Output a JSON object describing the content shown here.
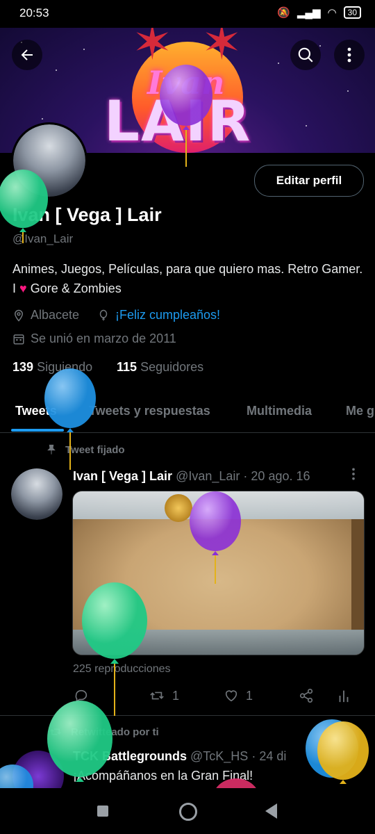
{
  "status_bar": {
    "time": "20:53",
    "battery": "30"
  },
  "banner": {
    "script_text": "Ivan",
    "title_text": "LAIR"
  },
  "header": {
    "back_icon": "arrow-left-icon",
    "search_icon": "search-icon",
    "more_icon": "more-vertical-icon"
  },
  "profile": {
    "edit_button": "Editar perfil",
    "name": "Ivan [ Vega ] Lair",
    "handle": "@Ivan_Lair",
    "bio_part1": "Animes, Juegos, Películas, para que quiero mas. Retro Gamer.  I ",
    "bio_heart": "♥",
    "bio_part2": " Gore & Zombies",
    "location": "Albacete",
    "birthday_link": "¡Feliz cumpleaños!",
    "joined": "Se unió en marzo de 2011",
    "following_count": "139",
    "following_label": "Siguiendo",
    "followers_count": "115",
    "followers_label": "Seguidores"
  },
  "tabs": [
    {
      "label": "Tweets",
      "active": true
    },
    {
      "label": "Tweets y respuestas",
      "active": false
    },
    {
      "label": "Multimedia",
      "active": false
    },
    {
      "label": "Me gusta",
      "active": false
    }
  ],
  "pinned_tweet": {
    "pinned_label": "Tweet fijado",
    "author": "Ivan [ Vega ] Lair",
    "handle": "@Ivan_Lair",
    "date": "· 20 ago. 16",
    "views": "225 reproducciones",
    "retweets": "1",
    "likes": "1"
  },
  "second_tweet": {
    "retweeted_label": "Retwitteado por ti",
    "author": "TCK Battlegrounds",
    "handle": "@TcK_HS",
    "date": "· 24 di",
    "text": "¡Acompáñanos en la Gran Final!"
  },
  "colors": {
    "accent": "#1d9bf0",
    "background": "#000000",
    "heart": "#f91880"
  }
}
